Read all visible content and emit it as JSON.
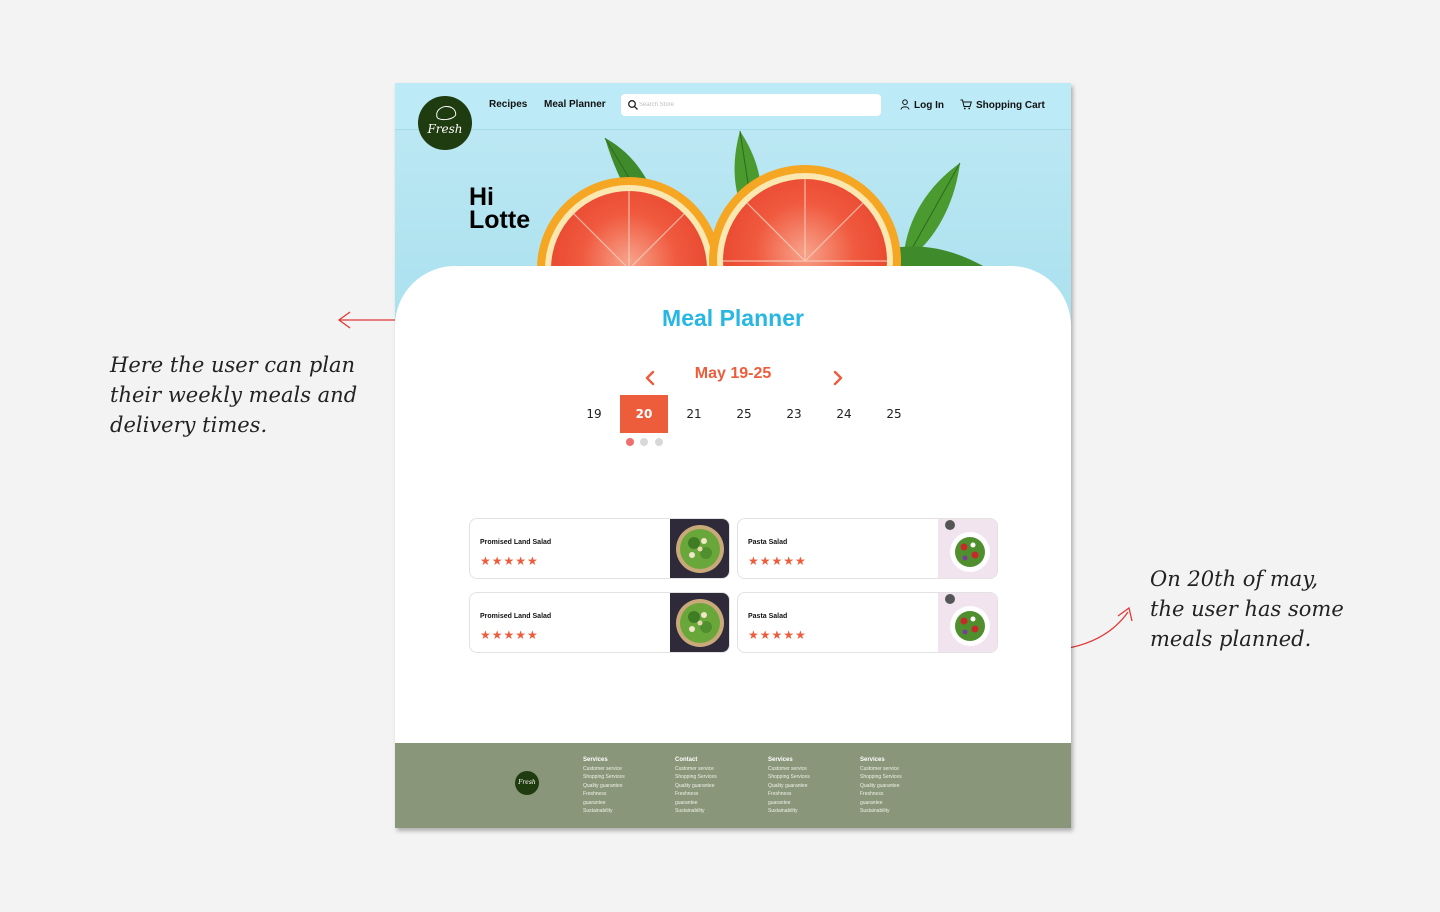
{
  "nav": {
    "logo_text": "Fresh",
    "links": [
      "Recipes",
      "Meal Planner"
    ],
    "search_placeholder": "Search Store",
    "login_label": "Log In",
    "cart_label": "Shopping Cart"
  },
  "hero": {
    "greeting_line1": "Hi",
    "greeting_line2": "Lotte"
  },
  "planner": {
    "title": "Meal Planner",
    "week_label": "May 19-25",
    "days": [
      "19",
      "20",
      "21",
      "25",
      "23",
      "24",
      "25"
    ],
    "selected_day": "20",
    "pager_dots": 3,
    "active_dot": 0
  },
  "meals": [
    {
      "name": "Promised Land Salad",
      "rating": 5
    },
    {
      "name": "Pasta Salad",
      "rating": 5
    },
    {
      "name": "Promised Land Salad",
      "rating": 5
    },
    {
      "name": "Pasta Salad",
      "rating": 5
    }
  ],
  "footer": {
    "logo_text": "Fresh",
    "columns": [
      {
        "title": "Services",
        "items": [
          "Customer service",
          "Shopping Services",
          "Quality guarantee",
          "Freshness",
          "guarantee",
          "Sustainability"
        ]
      },
      {
        "title": "Contact",
        "items": [
          "Customer service",
          "Shopping Services",
          "Quality guarantee",
          "Freshness",
          "guarantee",
          "Sustainability"
        ]
      },
      {
        "title": "Services",
        "items": [
          "Customer service",
          "Shopping Services",
          "Quality guarantee",
          "Freshness",
          "guarantee",
          "Sustainability"
        ]
      },
      {
        "title": "Services",
        "items": [
          "Customer service",
          "Shopping Services",
          "Quality guarantee",
          "Freshness",
          "guarantee",
          "Sustainability"
        ]
      }
    ]
  },
  "annotations": {
    "left": [
      "Here the user can plan",
      "their weekly meals and",
      "delivery times."
    ],
    "right": [
      "On 20th of may,",
      "the user has some",
      "meals planned."
    ]
  },
  "colors": {
    "accent": "#ed5d3c",
    "title_blue": "#27b7e2",
    "footer": "#8a967a",
    "nav_bg": "#bcebf7",
    "annotation_red": "#e23a3a"
  }
}
